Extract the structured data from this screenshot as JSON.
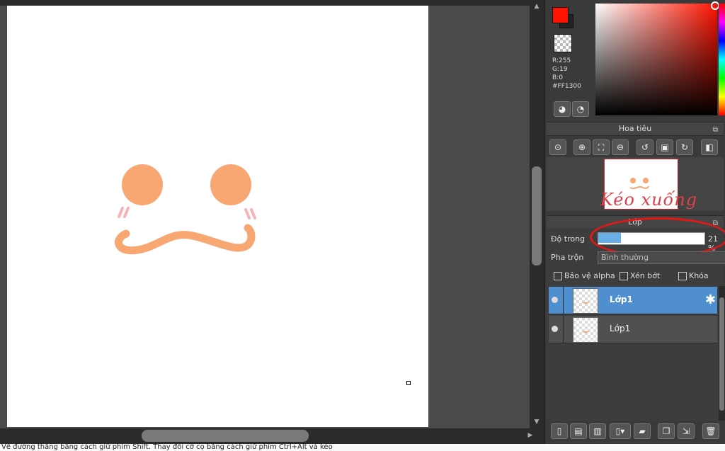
{
  "colors": {
    "foreground": "#ff1300",
    "accent_selection": "#4f8fcf",
    "annotation_red": "#e01818"
  },
  "color_info": {
    "r": "R:255",
    "g": "G:19",
    "b": "B:0",
    "hex": "#FF1300"
  },
  "navigator": {
    "title": "Hoa tiêu",
    "annotation": "Kéo xuống"
  },
  "layer_panel": {
    "title": "Lớp",
    "opacity_label": "Độ trong",
    "opacity_value": "21 %",
    "opacity_fraction": 0.21,
    "blend_label": "Pha trộn",
    "blend_value": "Bình thường",
    "protect_alpha": "Bảo vệ alpha",
    "clipping": "Xén bớt",
    "lock": "Khóa",
    "layers": [
      {
        "name": "Lớp1",
        "selected": true
      },
      {
        "name": "Lớp1",
        "selected": false
      }
    ]
  },
  "status_bar": {
    "text": "Vẽ đường thẳng bằng cách giữ phím Shift. Thay đổi cỡ cọ bằng cách giữ phím Ctrl+Alt và kéo"
  },
  "icons": {
    "palette_buttons": [
      "palette-icon",
      "eyedropper-palette-icon"
    ],
    "navigator_tools": [
      "zoom-actual-icon",
      "zoom-in-icon",
      "fit-icon",
      "zoom-out-icon",
      "rotate-left-icon",
      "fullscreen-icon",
      "rotate-right-icon",
      "flip-icon"
    ],
    "layer_tools": [
      "new-layer-icon",
      "new-layer-alt-icon",
      "new-layer-1bit-icon",
      "add-layer-dropdown-icon",
      "folder-icon",
      "duplicate-icon",
      "merge-icon",
      "delete-icon"
    ]
  }
}
